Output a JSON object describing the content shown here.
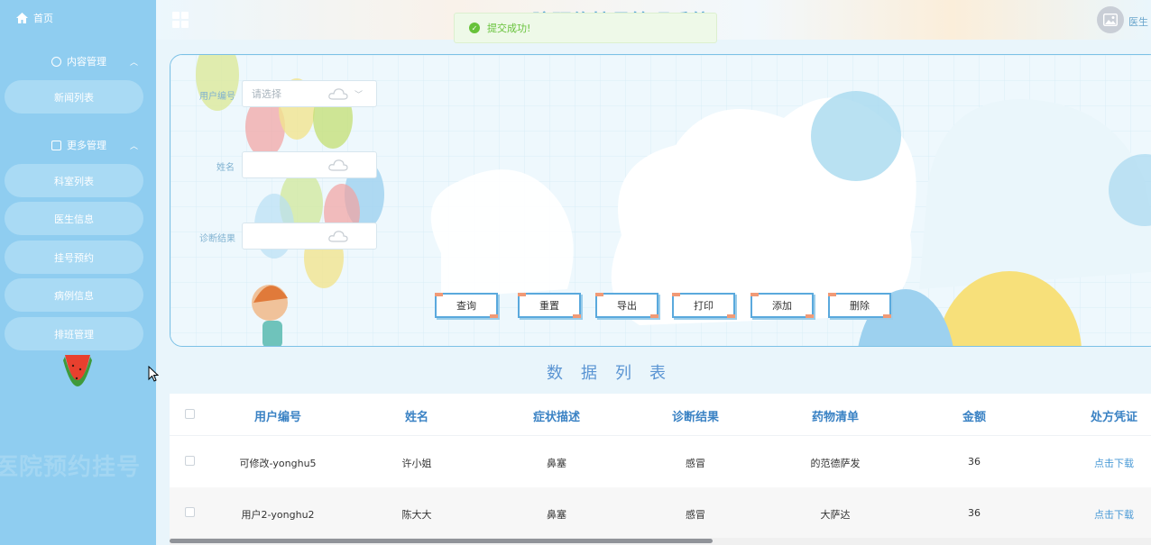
{
  "sidebar": {
    "home_label": "首页",
    "groups": [
      {
        "label": "内容管理",
        "items": [
          "新闻列表"
        ]
      },
      {
        "label": "更多管理",
        "items": [
          "科室列表",
          "医生信息",
          "挂号预约",
          "病例信息",
          "排班管理"
        ]
      }
    ],
    "watermark": "医院预约挂号"
  },
  "header": {
    "title": "医院预约挂号管理系统",
    "user_name": "医生"
  },
  "toast": {
    "message": "提交成功!"
  },
  "search": {
    "fields": [
      {
        "label": "用户编号",
        "placeholder": "请选择"
      },
      {
        "label": "姓名",
        "placeholder": ""
      },
      {
        "label": "诊断结果",
        "placeholder": ""
      }
    ],
    "buttons": [
      "查询",
      "重置",
      "导出",
      "打印",
      "添加",
      "删除"
    ]
  },
  "list_title": "数据列表",
  "table": {
    "columns": [
      "用户编号",
      "姓名",
      "症状描述",
      "诊断结果",
      "药物清单",
      "金额",
      "处方凭证"
    ],
    "rows": [
      [
        "可修改-yonghu5",
        "许小姐",
        "鼻塞",
        "感冒",
        "的范德萨发",
        "36",
        "点击下载"
      ],
      [
        "用户2-yonghu2",
        "陈大大",
        "鼻塞",
        "感冒",
        "大萨达",
        "36",
        "点击下载"
      ]
    ]
  },
  "colors": {
    "sidebar": "#8fcdf0",
    "accent": "#5aa9dd",
    "header_text": "#3a82c4",
    "success": "#67c23a",
    "button_corner": "#f19a76"
  }
}
